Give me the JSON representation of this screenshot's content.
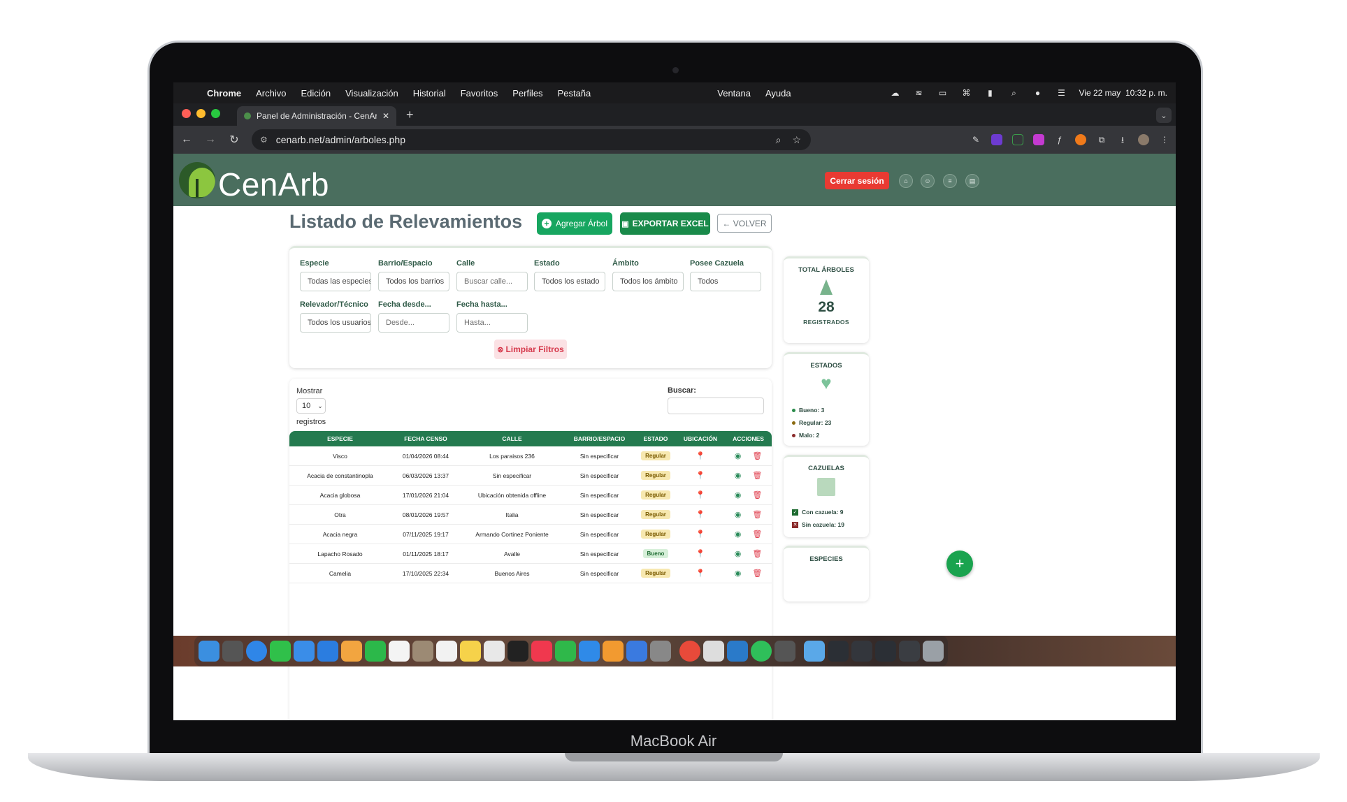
{
  "device": {
    "label": "MacBook Air"
  },
  "menubar": {
    "app": "Chrome",
    "items": [
      "Archivo",
      "Edición",
      "Visualización",
      "Historial",
      "Favoritos",
      "Perfiles",
      "Pestaña",
      "Ventana",
      "Ayuda"
    ],
    "clock": "Vie 22 may  10:32 p. m."
  },
  "browser": {
    "tab_title": "Panel de Administración - CenArb",
    "url": "cenarb.net/admin/arboles.php"
  },
  "header": {
    "logo_text": "CenArb",
    "logout_label": "Cerrar sesión"
  },
  "page": {
    "title": "Listado de Relevamientos",
    "add_label": "Agregar Árbol",
    "export_label": "EXPORTAR EXCEL",
    "back_label": "← VOLVER"
  },
  "filters": {
    "especie": {
      "label": "Especie",
      "value": "Todas las especies"
    },
    "barrio": {
      "label": "Barrio/Espacio",
      "value": "Todos los barrios"
    },
    "calle": {
      "label": "Calle",
      "placeholder": "Buscar calle..."
    },
    "estado": {
      "label": "Estado",
      "value": "Todos los estado"
    },
    "ambito": {
      "label": "Ámbito",
      "value": "Todos los ámbito"
    },
    "cazuela": {
      "label": "Posee Cazuela",
      "value": "Todos"
    },
    "relevador": {
      "label": "Relevador/Técnico",
      "value": "Todos los usuarios"
    },
    "desde": {
      "label": "Fecha desde...",
      "placeholder": "Desde..."
    },
    "hasta": {
      "label": "Fecha hasta...",
      "placeholder": "Hasta..."
    },
    "clear_label": "Limpiar Filtros"
  },
  "table": {
    "show_label": "Mostrar",
    "page_size": "10",
    "records_label": "registros",
    "search_label": "Buscar:",
    "columns": [
      "ESPECIE",
      "FECHA CENSO",
      "CALLE",
      "BARRIO/ESPACIO",
      "ESTADO",
      "UBICACIÓN",
      "ACCIONES"
    ],
    "rows": [
      {
        "especie": "Visco",
        "fecha": "01/04/2026 08:44",
        "calle": "Los paraisos 236",
        "barrio": "Sin especificar",
        "estado": "Regular"
      },
      {
        "especie": "Acacia de constantinopla",
        "fecha": "06/03/2026 13:37",
        "calle": "Sin especificar",
        "barrio": "Sin especificar",
        "estado": "Regular"
      },
      {
        "especie": "Acacia globosa",
        "fecha": "17/01/2026 21:04",
        "calle": "Ubicación obtenida offline",
        "barrio": "Sin especificar",
        "estado": "Regular"
      },
      {
        "especie": "Otra",
        "fecha": "08/01/2026 19:57",
        "calle": "Italia",
        "barrio": "Sin especificar",
        "estado": "Regular"
      },
      {
        "especie": "Acacia negra",
        "fecha": "07/11/2025 19:17",
        "calle": "Armando Cortinez Poniente",
        "barrio": "Sin especificar",
        "estado": "Regular"
      },
      {
        "especie": "Lapacho Rosado",
        "fecha": "01/11/2025 18:17",
        "calle": "Avalle",
        "barrio": "Sin especificar",
        "estado": "Bueno"
      },
      {
        "especie": "Camelia",
        "fecha": "17/10/2025 22:34",
        "calle": "Buenos Aires",
        "barrio": "Sin especificar",
        "estado": "Regular"
      }
    ]
  },
  "stats": {
    "total": {
      "title": "TOTAL ÁRBOLES",
      "value": "28",
      "sub": "REGISTRADOS"
    },
    "estados": {
      "title": "ESTADOS",
      "bueno": "Bueno: 3",
      "regular": "Regular: 23",
      "malo": "Malo: 2"
    },
    "cazuelas": {
      "title": "CAZUELAS",
      "con": "Con cazuela: 9",
      "sin": "Sin cazuela: 19"
    },
    "especies": {
      "title": "ESPECIES"
    }
  },
  "colors": {
    "header": "#4a6e5e",
    "accent": "#247a4f",
    "danger": "#e93a32"
  }
}
